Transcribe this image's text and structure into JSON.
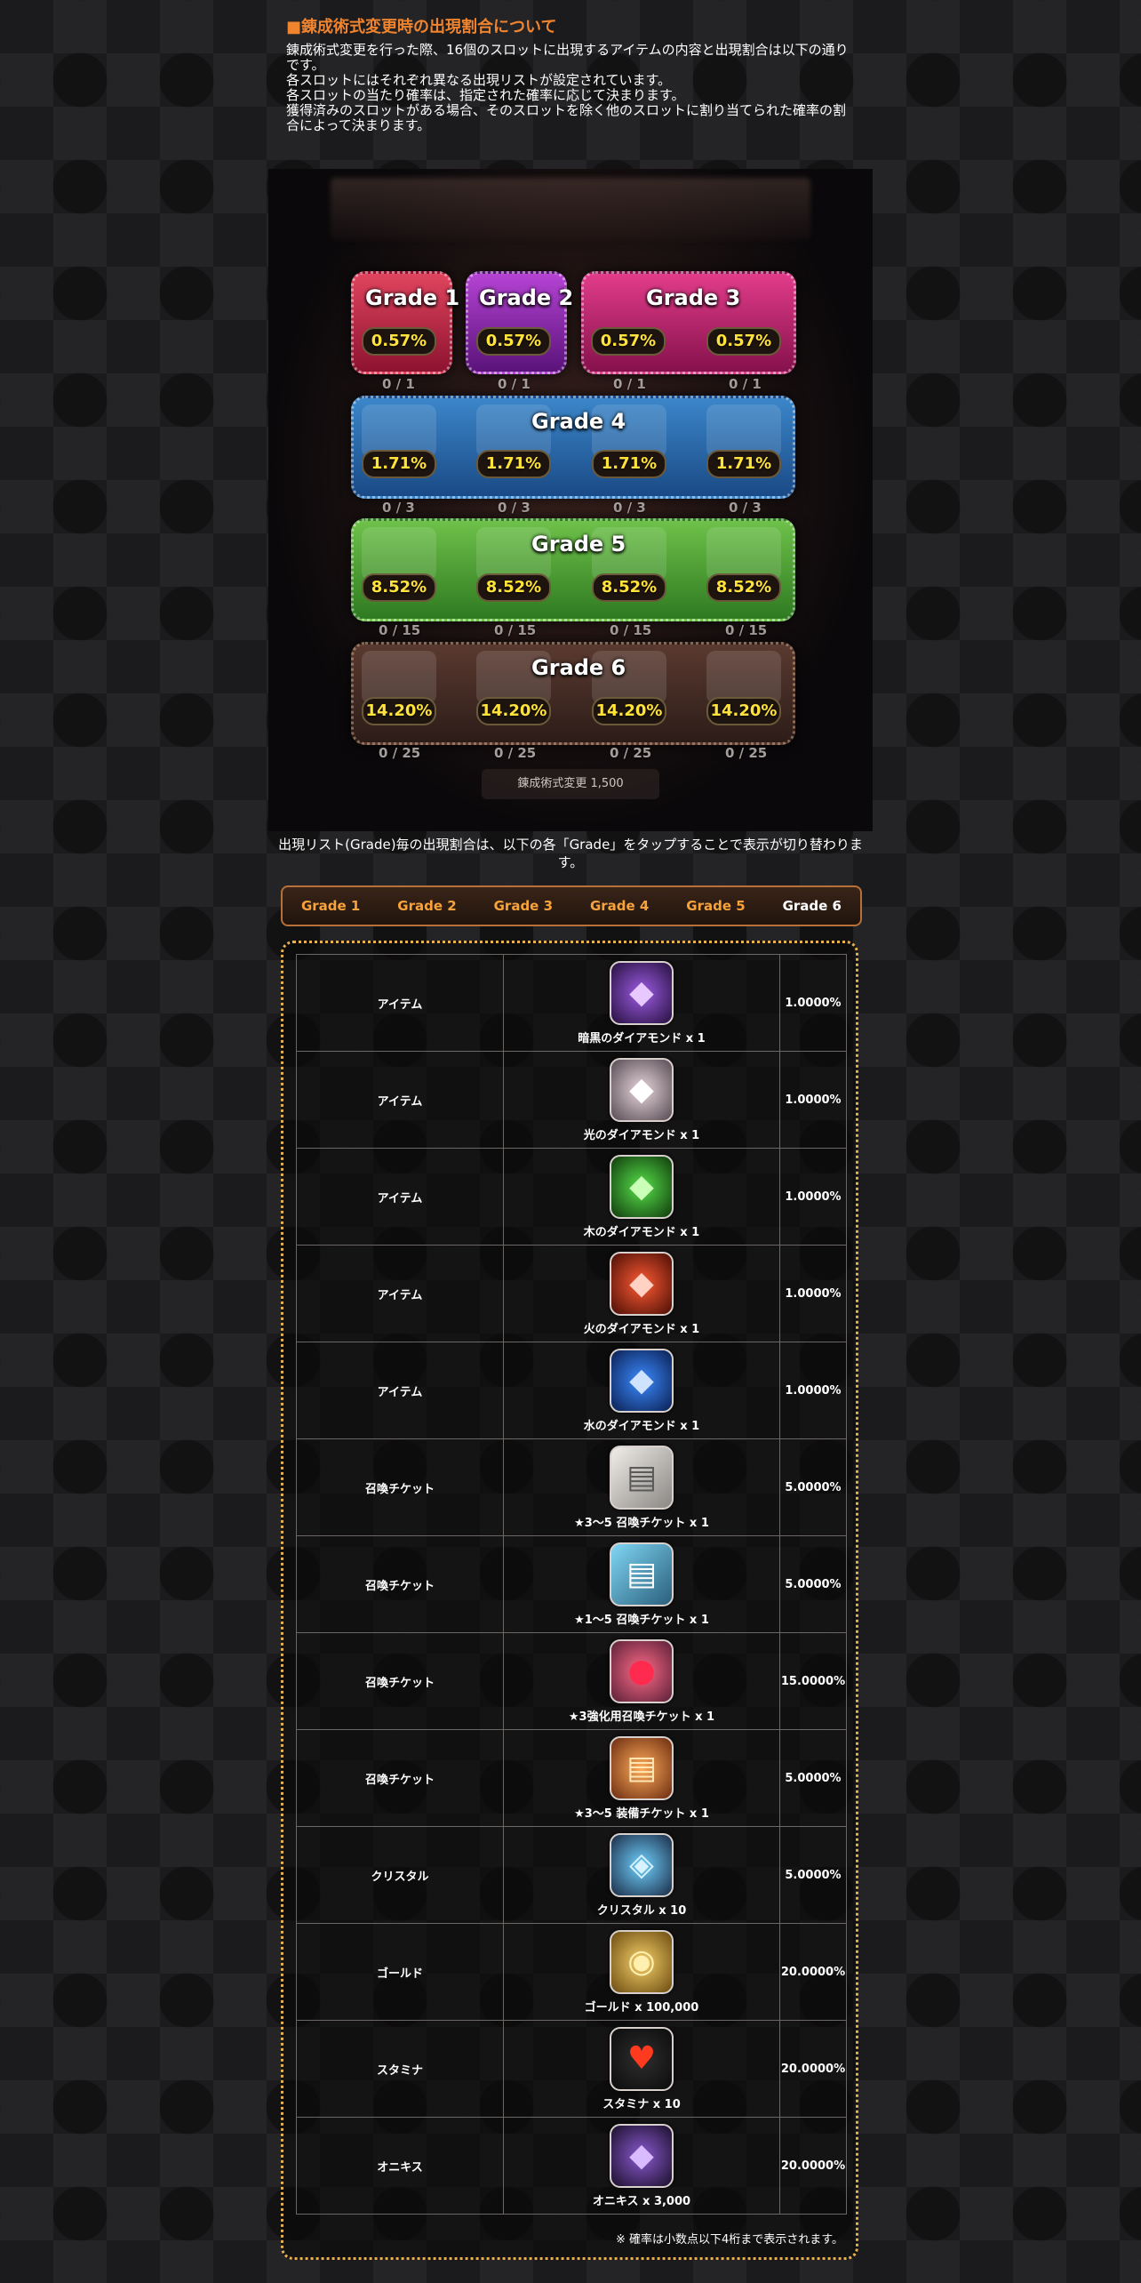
{
  "heading": "■錬成術式変更時の出現割合について",
  "description": [
    "錬成術式変更を行った際、16個のスロットに出現するアイテムの内容と出現割合は以下の通りです。",
    "各スロットにはそれぞれ異なる出現リストが設定されています。",
    "各スロットの当たり確率は、指定された確率に応じて決まります。",
    "獲得済みのスロットがある場合、そのスロットを除く他のスロットに割り当てられた確率の割合によって決まります。"
  ],
  "grade_image": {
    "grades": [
      {
        "label": "Grade 1",
        "rates": [
          "0.57%"
        ],
        "counts": [
          "0 / 1"
        ]
      },
      {
        "label": "Grade 2",
        "rates": [
          "0.57%"
        ],
        "counts": [
          "0 / 1"
        ]
      },
      {
        "label": "Grade 3",
        "rates": [
          "0.57%",
          "0.57%"
        ],
        "counts": [
          "0 / 1",
          "0 / 1"
        ]
      },
      {
        "label": "Grade 4",
        "rates": [
          "1.71%",
          "1.71%",
          "1.71%",
          "1.71%"
        ],
        "counts": [
          "0 / 3",
          "0 / 3",
          "0 / 3",
          "0 / 3"
        ]
      },
      {
        "label": "Grade 5",
        "rates": [
          "8.52%",
          "8.52%",
          "8.52%",
          "8.52%"
        ],
        "counts": [
          "0 / 15",
          "0 / 15",
          "0 / 15",
          "0 / 15"
        ]
      },
      {
        "label": "Grade 6",
        "rates": [
          "14.20%",
          "14.20%",
          "14.20%",
          "14.20%"
        ],
        "counts": [
          "0 / 25",
          "0 / 25",
          "0 / 25",
          "0 / 25"
        ]
      }
    ],
    "cost_text": "錬成術式変更  1,500"
  },
  "tab_note": "出現リスト(Grade)毎の出現割合は、以下の各「Grade」をタップすることで表示が切り替わります。",
  "tabs": [
    {
      "label": "Grade 1",
      "active": false
    },
    {
      "label": "Grade 2",
      "active": false
    },
    {
      "label": "Grade 3",
      "active": false
    },
    {
      "label": "Grade 4",
      "active": false
    },
    {
      "label": "Grade 5",
      "active": false
    },
    {
      "label": "Grade 6",
      "active": true
    }
  ],
  "rows": [
    {
      "category": "アイテム",
      "item": "暗黒のダイアモンド x 1",
      "rate": "1.0000%",
      "icon": "dark-diamond-icon",
      "glyph": "◆"
    },
    {
      "category": "アイテム",
      "item": "光のダイアモンド x 1",
      "rate": "1.0000%",
      "icon": "light-diamond-icon",
      "glyph": "◆"
    },
    {
      "category": "アイテム",
      "item": "木のダイアモンド x 1",
      "rate": "1.0000%",
      "icon": "wood-diamond-icon",
      "glyph": "◆"
    },
    {
      "category": "アイテム",
      "item": "火のダイアモンド x 1",
      "rate": "1.0000%",
      "icon": "fire-diamond-icon",
      "glyph": "◆"
    },
    {
      "category": "アイテム",
      "item": "水のダイアモンド x 1",
      "rate": "1.0000%",
      "icon": "water-diamond-icon",
      "glyph": "◆"
    },
    {
      "category": "召喚チケット",
      "item": "★3～5 召喚チケット x 1",
      "rate": "5.0000%",
      "icon": "summon-ticket-3-5-icon",
      "glyph": "▤"
    },
    {
      "category": "召喚チケット",
      "item": "★1～5 召喚チケット x 1",
      "rate": "5.0000%",
      "icon": "summon-ticket-1-5-icon",
      "glyph": "▤"
    },
    {
      "category": "召喚チケット",
      "item": "★3強化用召喚チケット x 1",
      "rate": "15.0000%",
      "icon": "enhance-summon-ticket-icon",
      "glyph": "●"
    },
    {
      "category": "召喚チケット",
      "item": "★3～5 装備チケット x 1",
      "rate": "5.0000%",
      "icon": "equipment-ticket-icon",
      "glyph": "▤"
    },
    {
      "category": "クリスタル",
      "item": "クリスタル x 10",
      "rate": "5.0000%",
      "icon": "crystal-icon",
      "glyph": "◈"
    },
    {
      "category": "ゴールド",
      "item": "ゴールド x 100,000",
      "rate": "20.0000%",
      "icon": "gold-icon",
      "glyph": "◉"
    },
    {
      "category": "スタミナ",
      "item": "スタミナ x 10",
      "rate": "20.0000%",
      "icon": "stamina-icon",
      "glyph": "♥"
    },
    {
      "category": "オニキス",
      "item": "オニキス x 3,000",
      "rate": "20.0000%",
      "icon": "onyx-icon",
      "glyph": "◆"
    }
  ],
  "footnote": "※ 確率は小数点以下4桁まで表示されます。",
  "colors": {
    "heading": "#f0842e",
    "tab_inactive": "#f7a23a",
    "tab_active": "#ffffff",
    "panel_border": "#e6b04e",
    "rate_text": "#ffe23a"
  }
}
